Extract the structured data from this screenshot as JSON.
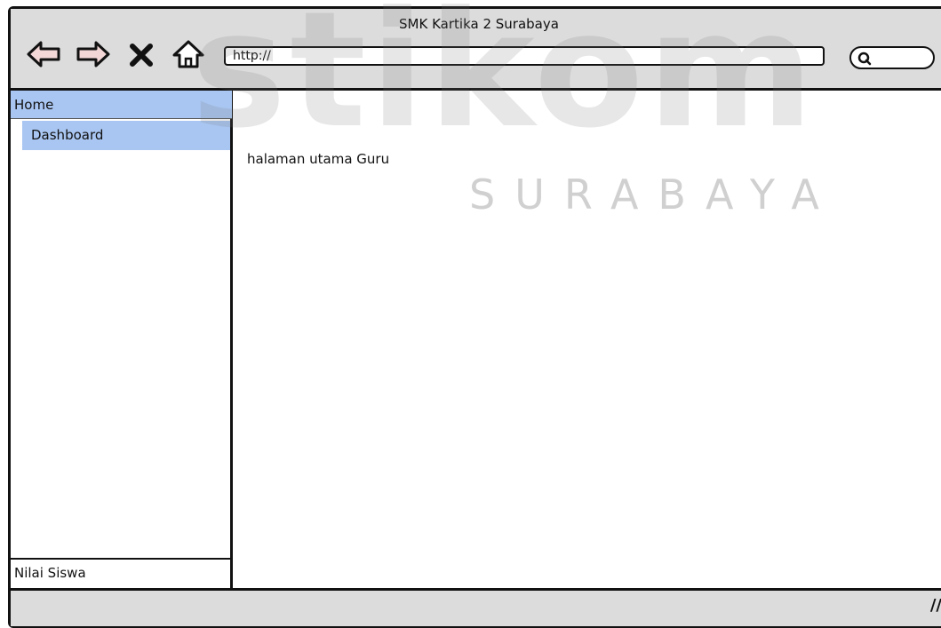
{
  "watermark": {
    "brand": "stikom",
    "city": "SURABAYA"
  },
  "browser": {
    "title": "SMK Kartika 2 Surabaya",
    "url": "http://",
    "icons": [
      "back-arrow-icon",
      "forward-arrow-icon",
      "close-icon",
      "home-icon",
      "search-icon"
    ]
  },
  "sidebar": {
    "home_label": "Home",
    "dashboard_label": "Dashboard",
    "nilai_label": "Nilai Siswa"
  },
  "main": {
    "text": "halaman utama Guru"
  },
  "colors": {
    "selected_bg": "#a9c6f2",
    "chrome_bg": "#dcdcdc"
  }
}
